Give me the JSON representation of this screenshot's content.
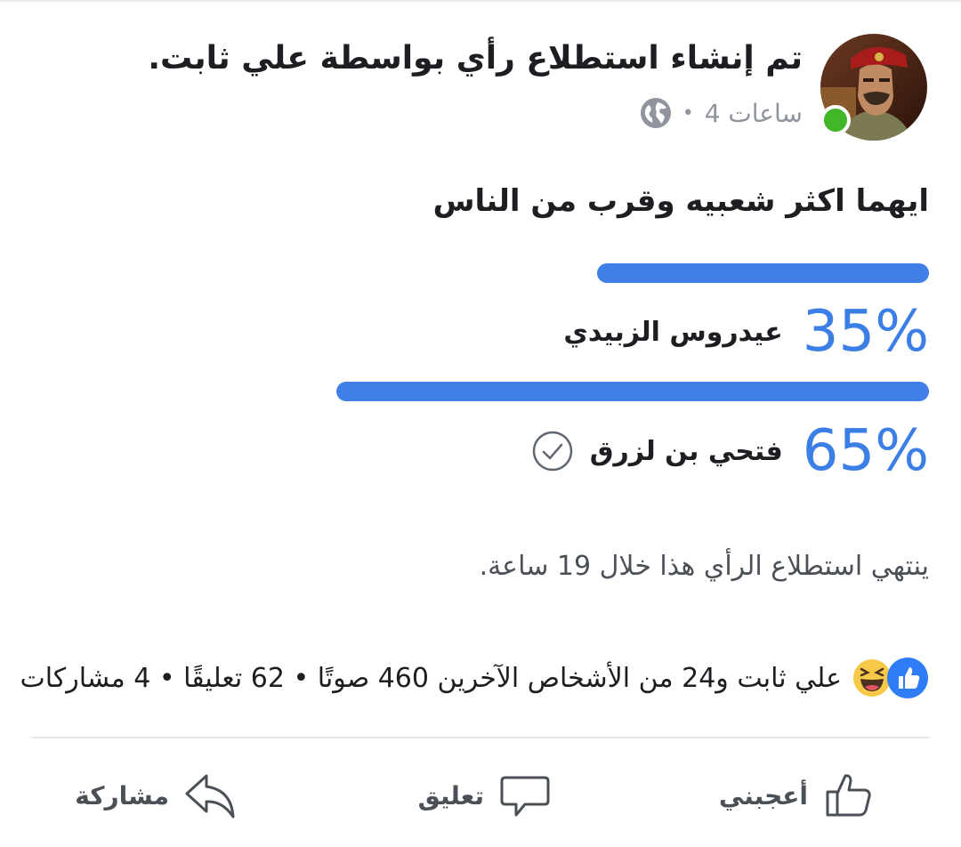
{
  "post": {
    "header_title": "تم إنشاء استطلاع رأي بواسطة علي ثابت.",
    "time": "4 ساعات",
    "separator": "•",
    "privacy_icon": "globe-icon",
    "question": "ايهما اكثر شعبيه وقرب من الناس"
  },
  "poll": {
    "options": [
      {
        "label": "عيدروس الزبيدي",
        "percent_text": "35%",
        "share": 0.35,
        "selected": false
      },
      {
        "label": "فتحي بن لزرق",
        "percent_text": "65%",
        "share": 0.65,
        "selected": true
      }
    ],
    "ends_text": "ينتهي استطلاع الرأي هذا خلال 19 ساعة.",
    "bar_color": "#4080e6",
    "percent_color": "#3b7ee5"
  },
  "reactions": {
    "icons": [
      "like-reaction-icon",
      "haha-reaction-icon"
    ],
    "text": "علي ثابت و24 من الأشخاص الآخرين 460 صوتًا • 62 تعليقًا • 4 مشاركات"
  },
  "actions": {
    "like": "أعجبني",
    "comment": "تعليق",
    "share": "مشاركة"
  },
  "colors": {
    "online": "#42b72a",
    "accent": "#3b7ee5",
    "muted": "#90949c"
  }
}
